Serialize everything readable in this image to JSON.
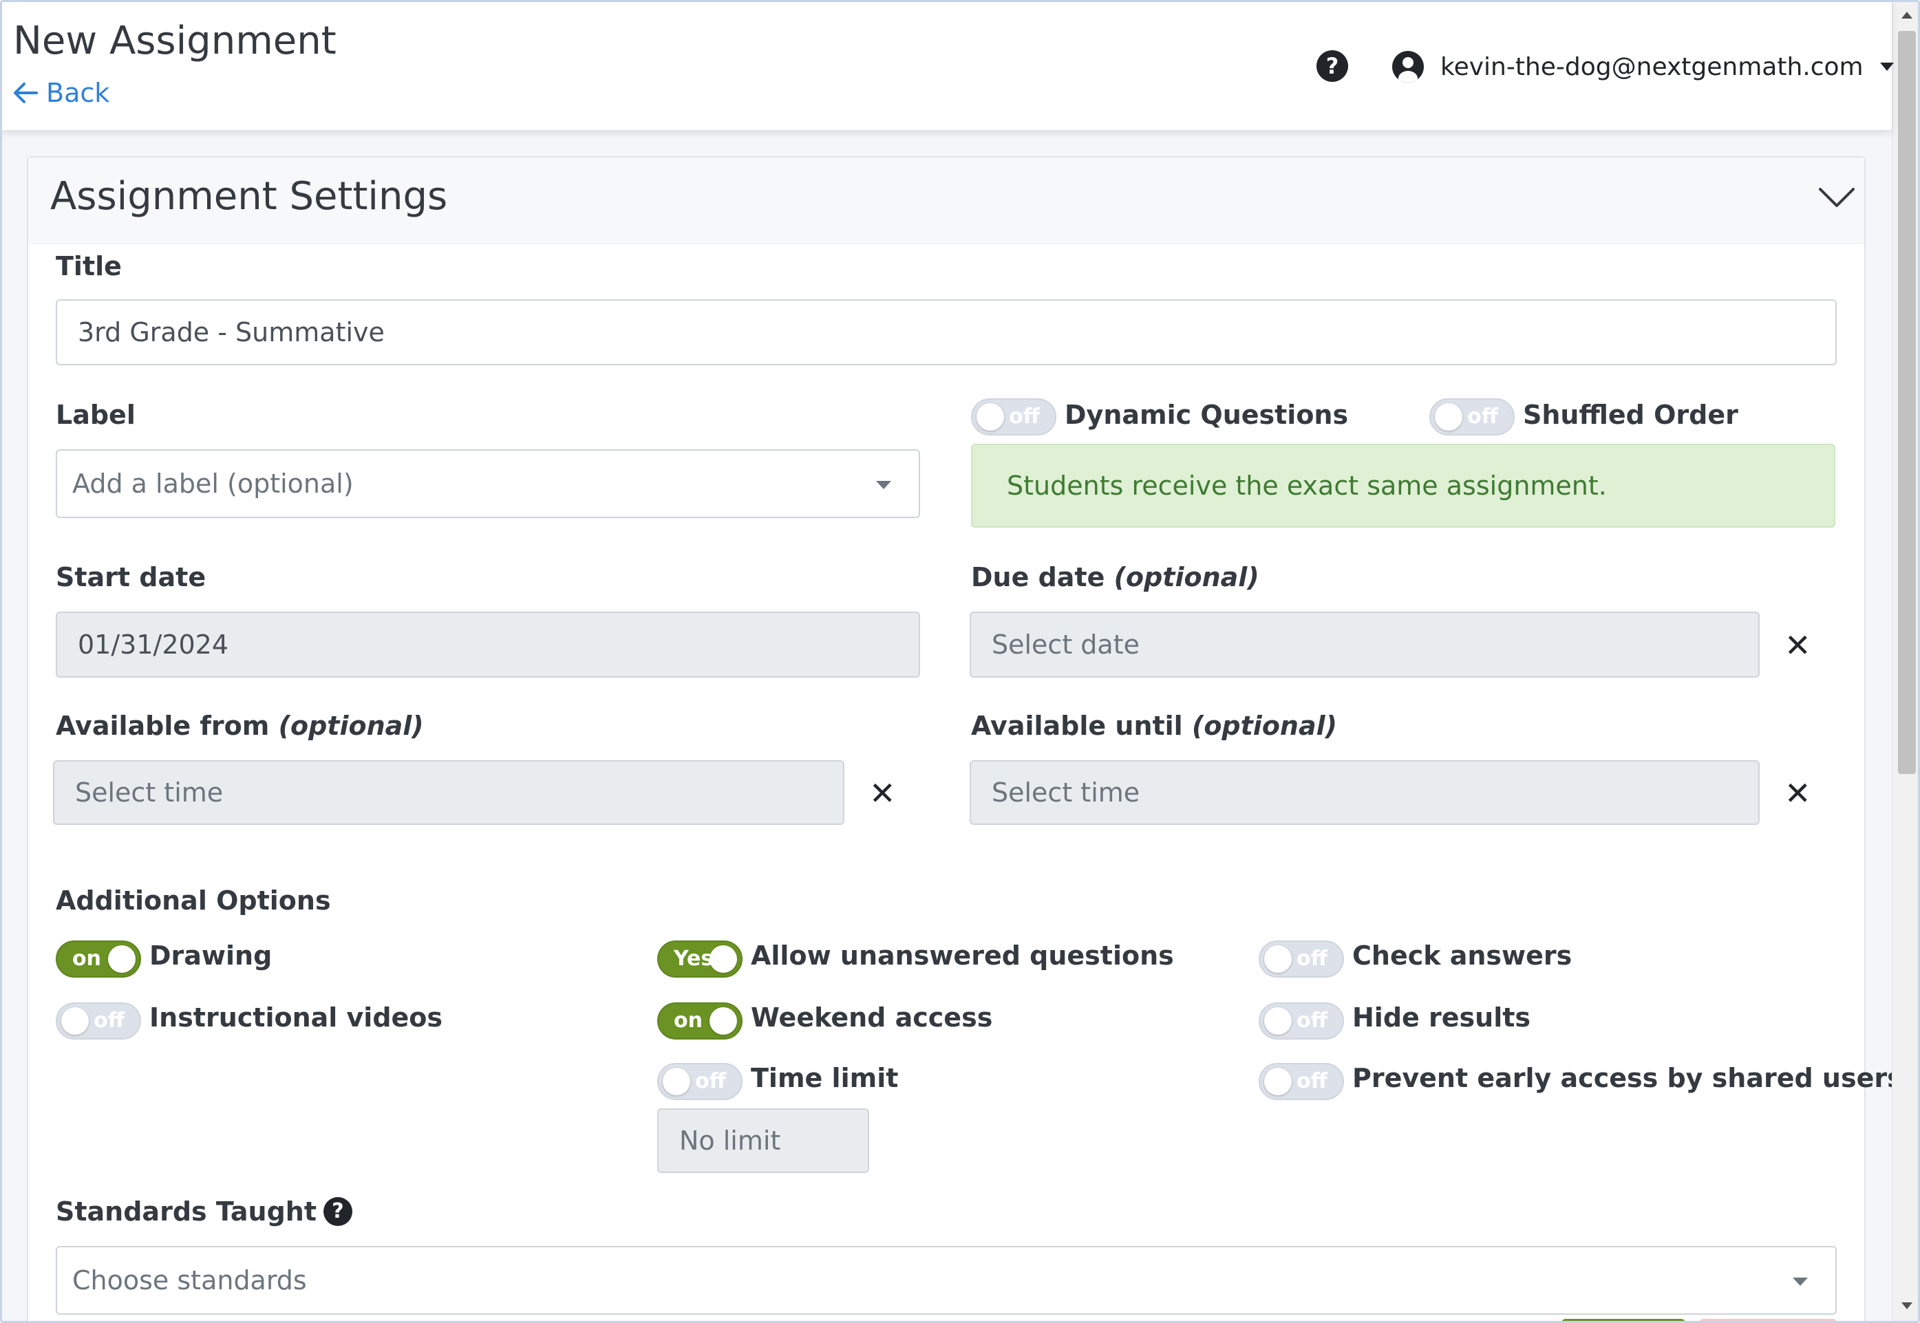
{
  "header": {
    "title": "New Assignment",
    "back_label": "Back",
    "user_email": "kevin-the-dog@nextgenmath.com",
    "help_icon": "question-circle-icon",
    "user_icon": "user-circle-icon"
  },
  "settings": {
    "card_title": "Assignment Settings",
    "title_label": "Title",
    "title_value": "3rd Grade - Summative",
    "label_label": "Label",
    "label_placeholder": "Add a label (optional)",
    "dynamic_questions": {
      "label": "Dynamic Questions",
      "state": "off"
    },
    "shuffled_order": {
      "label": "Shuffled Order",
      "state": "off"
    },
    "info_message": "Students receive the exact same assignment.",
    "start_date_label": "Start date",
    "start_date_value": "01/31/2024",
    "due_date_label": "Due date",
    "due_date_optional": "(optional)",
    "due_date_placeholder": "Select date",
    "available_from_label": "Available from",
    "available_from_optional": "(optional)",
    "available_from_placeholder": "Select time",
    "available_until_label": "Available until",
    "available_until_optional": "(optional)",
    "available_until_placeholder": "Select time",
    "clear_symbol": "✕"
  },
  "options": {
    "heading": "Additional Options",
    "drawing": {
      "label": "Drawing",
      "state": "on"
    },
    "instructional_videos": {
      "label": "Instructional videos",
      "state": "off"
    },
    "allow_unanswered": {
      "label": "Allow unanswered questions",
      "state": "Yes"
    },
    "weekend_access": {
      "label": "Weekend access",
      "state": "on"
    },
    "time_limit": {
      "label": "Time limit",
      "state": "off"
    },
    "time_limit_placeholder": "No limit",
    "check_answers": {
      "label": "Check answers",
      "state": "off"
    },
    "hide_results": {
      "label": "Hide results",
      "state": "off"
    },
    "prevent_early_access": {
      "label": "Prevent early access by shared users",
      "state": "off"
    }
  },
  "standards": {
    "label": "Standards Taught",
    "help_symbol": "?",
    "placeholder": "Choose standards"
  },
  "colors": {
    "toggle_on": "#6a9323",
    "toggle_off": "#dde2ea",
    "link": "#2f80d8",
    "alert_bg": "#dff0d5",
    "alert_text": "#3f7a32"
  }
}
